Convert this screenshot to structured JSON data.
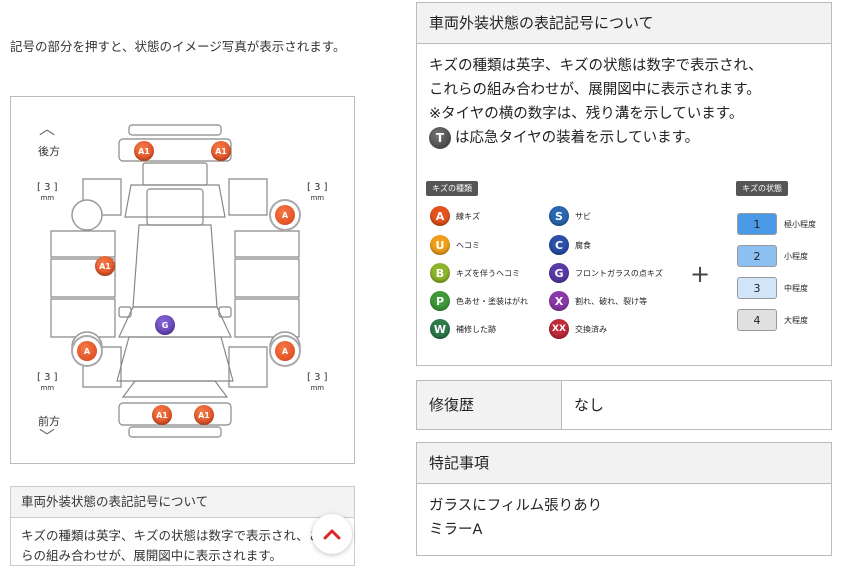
{
  "left": {
    "instruction": "記号の部分を押すと、状態のイメージ写真が表示されます。",
    "diagram": {
      "rear_label": "後方",
      "front_label": "前方",
      "tread_value": "[ 3 ]",
      "tread_unit": "mm",
      "marks": [
        {
          "code": "A1",
          "color": "orange"
        },
        {
          "code": "A1",
          "color": "orange"
        },
        {
          "code": "A",
          "color": "orange"
        },
        {
          "code": "A1",
          "color": "orange"
        },
        {
          "code": "G",
          "color": "purple"
        },
        {
          "code": "A",
          "color": "orange"
        },
        {
          "code": "A",
          "color": "orange"
        },
        {
          "code": "A1",
          "color": "orange"
        },
        {
          "code": "A1",
          "color": "orange"
        }
      ]
    },
    "panel2": {
      "title": "車両外装状態の表記記号について",
      "body": "キズの種類は英字、キズの状態は数字で表示され、これらの組み合わせが、展開図中に表示されます。"
    }
  },
  "legend": {
    "title": "車両外装状態の表記記号について",
    "line1": "キズの種類は英字、キズの状態は数字で表示され、",
    "line2": "これらの組み合わせが、展開図中に表示されます。",
    "line3": "※タイヤの横の数字は、残り溝を示しています。",
    "line4_icon": "T",
    "line4_text": "は応急タイヤの装着を示しています。",
    "kind_tag": "キズの種類",
    "state_tag": "キズの状態",
    "kinds": [
      {
        "code": "A",
        "label": "線キズ",
        "color": "#e5531d"
      },
      {
        "code": "U",
        "label": "ヘコミ",
        "color": "#f0a01a"
      },
      {
        "code": "B",
        "label": "キズを伴うヘコミ",
        "color": "#8cb52a"
      },
      {
        "code": "P",
        "label": "色あせ・塗装はがれ",
        "color": "#3f9a3a"
      },
      {
        "code": "W",
        "label": "補修した跡",
        "color": "#2d7a4a"
      },
      {
        "code": "S",
        "label": "サビ",
        "color": "#2a67b0"
      },
      {
        "code": "C",
        "label": "腐食",
        "color": "#2a4fa8"
      },
      {
        "code": "G",
        "label": "フロントガラスの点キズ",
        "color": "#5a3aa8"
      },
      {
        "code": "X",
        "label": "割れ、破れ、裂け等",
        "color": "#8a3aa8"
      },
      {
        "code": "XX",
        "label": "交換済み",
        "color": "#c02a3a"
      }
    ],
    "plus": "+",
    "levels": [
      {
        "num": "1",
        "label": "極小程度",
        "color": "#4a9ae8"
      },
      {
        "num": "2",
        "label": "小程度",
        "color": "#8cc0f0"
      },
      {
        "num": "3",
        "label": "中程度",
        "color": "#d0e6f8"
      },
      {
        "num": "4",
        "label": "大程度",
        "color": "#e0e0e0"
      }
    ]
  },
  "repair": {
    "label": "修復歴",
    "value": "なし"
  },
  "notes": {
    "title": "特記事項",
    "line1": "ガラスにフィルム張りあり",
    "line2": "ミラーA"
  }
}
